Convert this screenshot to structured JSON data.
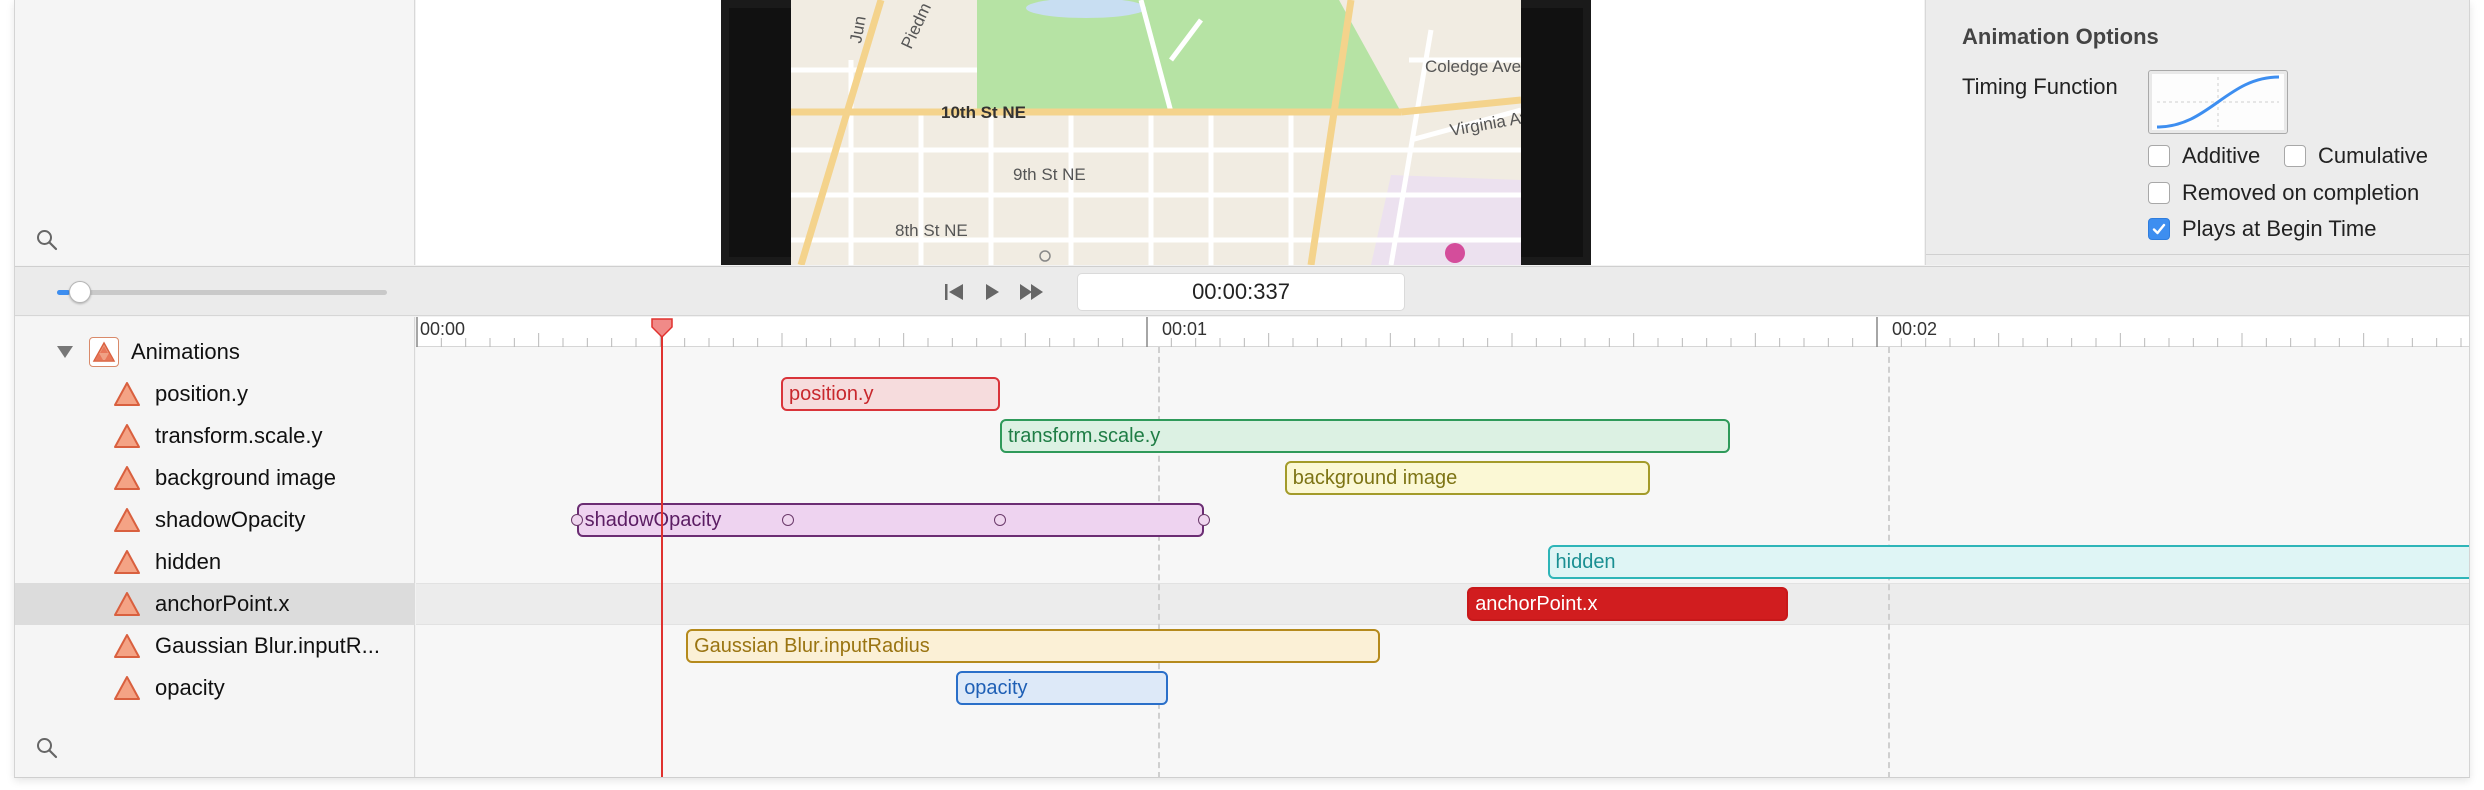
{
  "inspector": {
    "title": "Animation Options",
    "timing_label": "Timing Function",
    "options": [
      {
        "label": "Additive",
        "checked": false
      },
      {
        "label": "Cumulative",
        "checked": false
      },
      {
        "label": "Removed on completion",
        "checked": false
      },
      {
        "label": "Plays at Begin Time",
        "checked": true
      }
    ]
  },
  "map": {
    "streets": [
      "Piedm",
      "Jun",
      "10th St NE",
      "9th St NE",
      "8th St NE",
      "Coledge Ave",
      "Virginia Av"
    ]
  },
  "transport": {
    "time": "00:00:337",
    "speed_level": 0.04
  },
  "ruler": {
    "labels": [
      "00:00",
      "00:01",
      "00:02"
    ]
  },
  "tracks": {
    "group_label": "Animations",
    "items": [
      {
        "label": "position.y"
      },
      {
        "label": "transform.scale.y"
      },
      {
        "label": "background image"
      },
      {
        "label": "shadowOpacity"
      },
      {
        "label": "hidden"
      },
      {
        "label": "anchorPoint.x"
      },
      {
        "label": "Gaussian Blur.inputR..."
      },
      {
        "label": "opacity"
      }
    ]
  },
  "bars": [
    {
      "label": "position.y",
      "start": 0.5,
      "end": 0.8,
      "border": "#d9343a",
      "fill": "#f6dcdd",
      "text": "#c8282d"
    },
    {
      "label": "transform.scale.y",
      "start": 0.8,
      "end": 1.8,
      "border": "#2f9a5a",
      "fill": "#dcf1e3",
      "text": "#1f7d45"
    },
    {
      "label": "background image",
      "start": 1.19,
      "end": 1.69,
      "border": "#a39b2a",
      "fill": "#fbf8d5",
      "text": "#7d7415"
    },
    {
      "label": "shadowOpacity",
      "start": 0.22,
      "end": 1.08,
      "border": "#6b2d73",
      "fill": "#eed3f0",
      "text": "#5b1d63"
    },
    {
      "label": "hidden",
      "start": 1.55,
      "end": 2.9,
      "border": "#2eb5b8",
      "fill": "#dff5f5",
      "text": "#1a8f92"
    },
    {
      "label": "anchorPoint.x",
      "start": 1.44,
      "end": 1.88,
      "border": "#c8181a",
      "fill": "#d11d1f",
      "text": "#ffffff"
    },
    {
      "label": "Gaussian Blur.inputRadius",
      "start": 0.37,
      "end": 1.32,
      "border": "#b58a1c",
      "fill": "#fbf0d6",
      "text": "#9a7411"
    },
    {
      "label": "opacity",
      "start": 0.74,
      "end": 1.03,
      "border": "#2a6fc9",
      "fill": "#dde9f8",
      "text": "#1e5fb5"
    }
  ],
  "keyframes": [
    0.22,
    0.51,
    0.8,
    1.08
  ],
  "playhead_seconds": 0.337,
  "selected_track": 5,
  "colors": {
    "accent": "#3d8ef0",
    "playhead": "#e0322f",
    "track_icon": "#e8775a"
  }
}
